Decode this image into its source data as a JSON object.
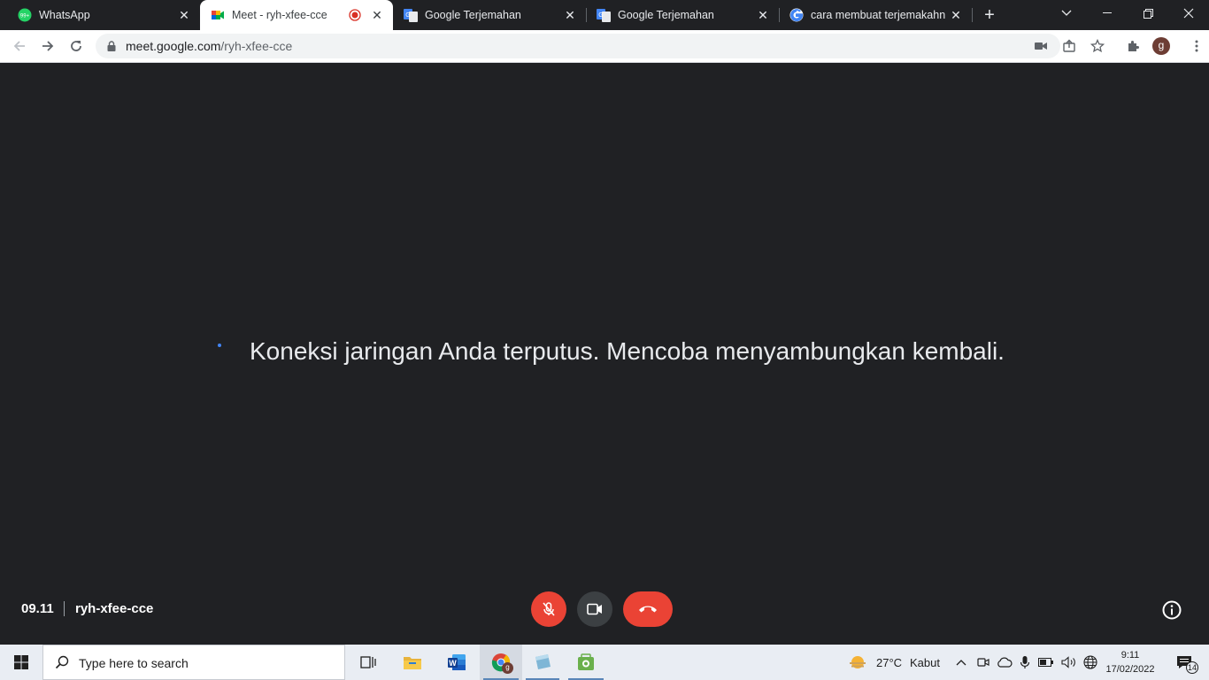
{
  "browser": {
    "tabs": [
      {
        "title": "WhatsApp",
        "icon": "whatsapp-icon",
        "badge": "99+"
      },
      {
        "title": "Meet - ryh-xfee-cce",
        "icon": "google-meet-icon",
        "active": true,
        "recording": true
      },
      {
        "title": "Google Terjemahan",
        "icon": "google-translate-icon"
      },
      {
        "title": "Google Terjemahan",
        "icon": "google-translate-icon"
      },
      {
        "title": "cara membuat terjemakahn c",
        "icon": "google-icon"
      }
    ],
    "url_host": "meet.google.com",
    "url_path": "/ryh-xfee-cce",
    "profile_initial": "g"
  },
  "meet": {
    "status_message": "Koneksi jaringan Anda terputus. Mencoba menyambungkan kembali.",
    "time": "09.11",
    "meeting_code": "ryh-xfee-cce",
    "mic_state": "muted",
    "colors": {
      "background": "#202124",
      "danger": "#ea4335",
      "control": "#3c4043"
    }
  },
  "taskbar": {
    "search_placeholder": "Type here to search",
    "weather_temp": "27°C",
    "weather_desc": "Kabut",
    "clock_time": "9:11",
    "clock_date": "17/02/2022",
    "notification_count": "14",
    "chrome_badge": "g"
  }
}
